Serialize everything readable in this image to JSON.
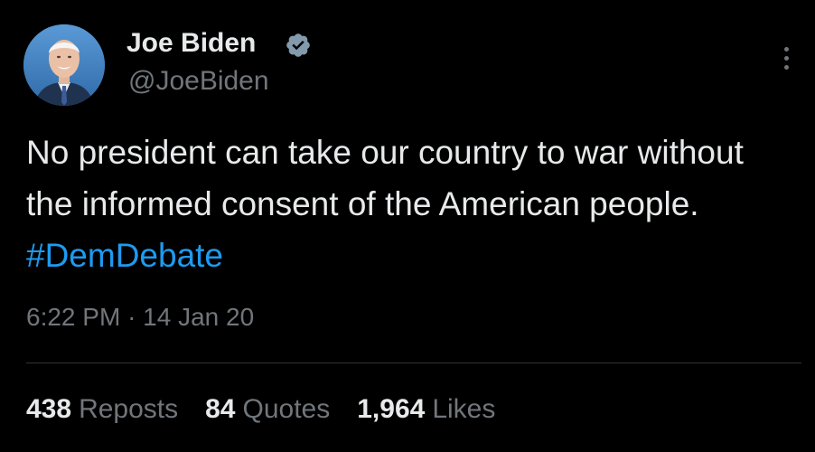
{
  "author": {
    "name": "Joe Biden",
    "handle": "@JoeBiden",
    "avatar": "avatar-photo",
    "verified": true,
    "verified_icon": "verified-badge-icon"
  },
  "menu_icon": "more-options-icon",
  "tweet": {
    "text": "No president can take our country to war without the informed consent of the American people.",
    "hashtag": "#DemDebate"
  },
  "meta": {
    "time": "6:22 PM",
    "separator": "·",
    "date": "14 Jan 20"
  },
  "stats": {
    "reposts_count": "438",
    "reposts_label": "Reposts",
    "quotes_count": "84",
    "quotes_label": "Quotes",
    "likes_count": "1,964",
    "likes_label": "Likes"
  },
  "colors": {
    "background": "#000000",
    "text": "#e7e9ea",
    "secondary": "#71767b",
    "link": "#1d9bf0",
    "divider": "#2f3336",
    "verified_badge": "#829aab"
  }
}
